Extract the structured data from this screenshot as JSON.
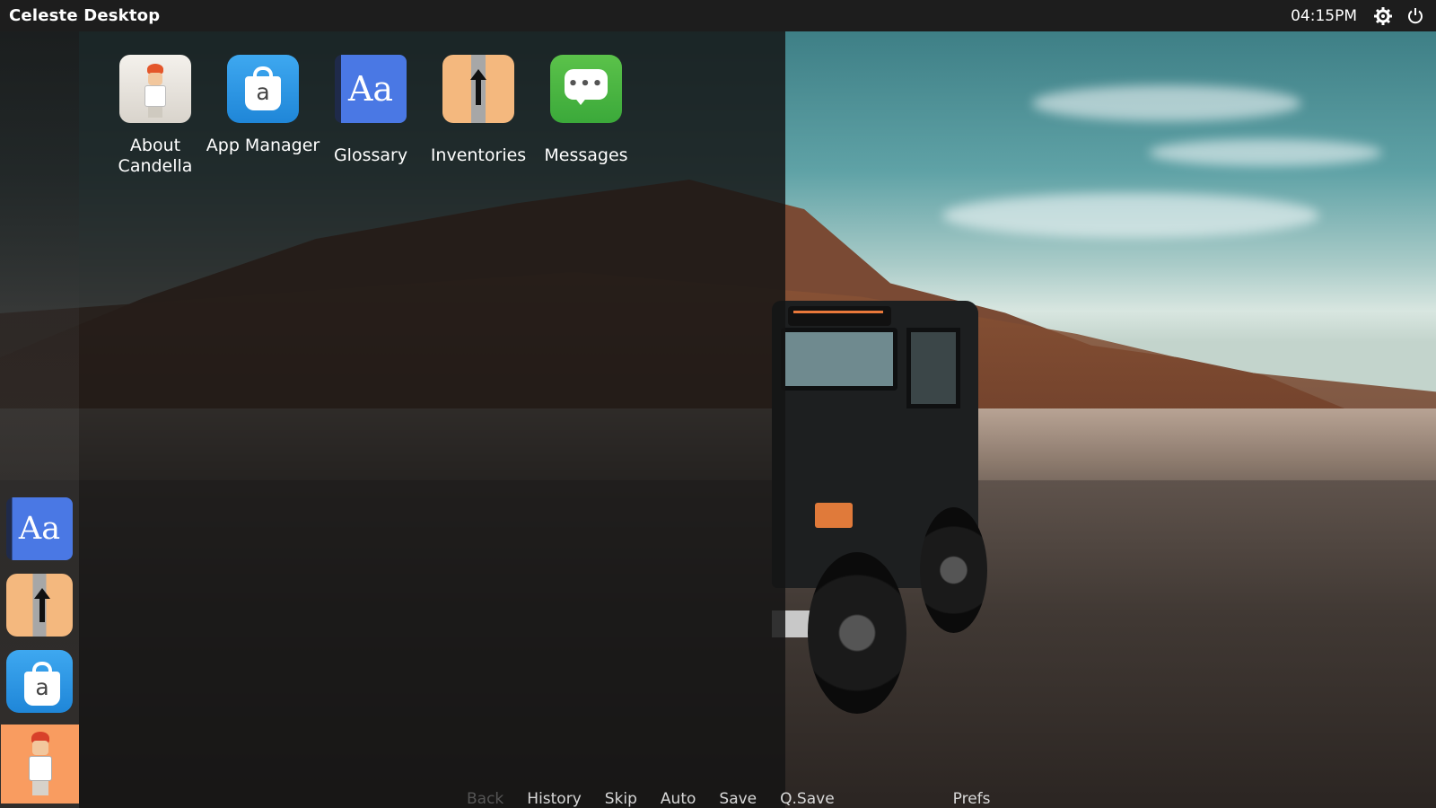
{
  "topbar": {
    "title": "Celeste Desktop",
    "clock": "04:15PM",
    "settings_icon": "gear-icon",
    "power_icon": "power-icon"
  },
  "launcher": {
    "apps": [
      {
        "label": "About Candella",
        "icon": "about-candella-icon"
      },
      {
        "label": "App Manager",
        "icon": "app-manager-icon"
      },
      {
        "label": "Glossary",
        "icon": "glossary-icon"
      },
      {
        "label": "Inventories",
        "icon": "inventories-icon"
      },
      {
        "label": "Messages",
        "icon": "messages-icon"
      }
    ]
  },
  "dock": {
    "items": [
      {
        "name": "Glossary",
        "icon": "glossary-icon"
      },
      {
        "name": "Inventories",
        "icon": "inventories-icon"
      },
      {
        "name": "App Manager",
        "icon": "app-manager-icon"
      },
      {
        "name": "About Candella",
        "icon": "about-candella-icon",
        "active": true
      }
    ]
  },
  "quickmenu": {
    "back": "Back",
    "history": "History",
    "skip": "Skip",
    "auto": "Auto",
    "save": "Save",
    "qsave": "Q.Save",
    "prefs": "Prefs"
  },
  "colors": {
    "topbar_bg": "#1d1d1d",
    "launcher_overlay": "#141414",
    "dock_active": "#f99c60",
    "glossary_blue": "#4a78e4",
    "app_manager_blue": "#2b96e4",
    "messages_green": "#4cb543",
    "inventories_orange": "#f4b87e"
  }
}
